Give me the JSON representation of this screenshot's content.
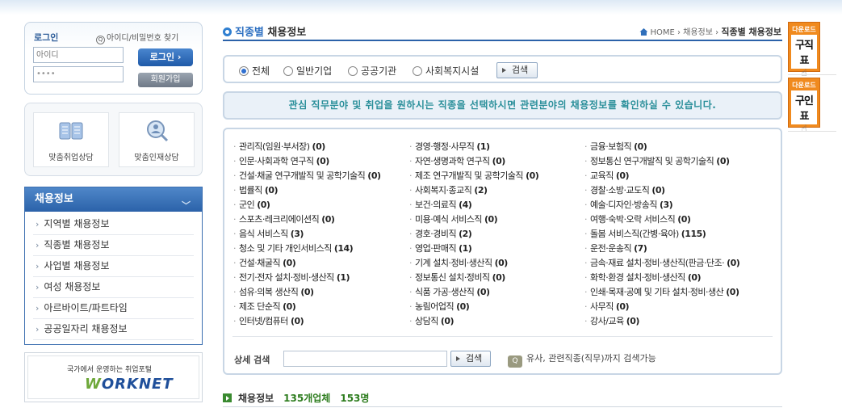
{
  "login": {
    "title": "로그인",
    "find_link": "아이디/비밀번호 찾기",
    "id_placeholder": "아이디",
    "pw_value": "••••",
    "login_button": "로그인",
    "join_button": "회원가입"
  },
  "consult": {
    "item1": "맞춤취업상담",
    "item2": "맞춤인재상담"
  },
  "side_menu": {
    "title": "채용정보",
    "items": [
      "지역별 채용정보",
      "직종별 채용정보",
      "사업별 채용정보",
      "여성 채용정보",
      "아르바이트/파트타임",
      "공공일자리 채용정보"
    ]
  },
  "banner": {
    "tagline": "국가에서 운영하는 취업포털",
    "logo": "ORKNET",
    "logo_w": "W"
  },
  "page": {
    "title_prefix": "직종별",
    "title_suffix": "채용정보",
    "breadcrumb": {
      "home": "HOME",
      "level1": "채용정보",
      "current": "직종별 채용정보"
    }
  },
  "filter": {
    "options": [
      "전체",
      "일반기업",
      "공공기관",
      "사회복지시설"
    ],
    "selected_index": 0,
    "search_button": "검색"
  },
  "notice": "관심 직무분야 및 취업을 원하시는 직종을 선택하시면 관련분야의 채용정보를 확인하실 수 있습니다.",
  "categories": {
    "col1": [
      {
        "name": "관리직(임원·부서장)",
        "count": "(0)"
      },
      {
        "name": "인문·사회과학 연구직",
        "count": "(0)"
      },
      {
        "name": "건설·채굴 연구개발직 및 공학기술직",
        "count": "(0)"
      },
      {
        "name": "법률직",
        "count": "(0)"
      },
      {
        "name": "군인",
        "count": "(0)"
      },
      {
        "name": "스포츠·레크리에이션직",
        "count": "(0)"
      },
      {
        "name": "음식 서비스직",
        "count": "(3)"
      },
      {
        "name": "청소 및 기타 개인서비스직",
        "count": "(14)"
      },
      {
        "name": "건설·채굴직",
        "count": "(0)"
      },
      {
        "name": "전기·전자 설치·정비·생산직",
        "count": "(1)"
      },
      {
        "name": "섬유·의복 생산직",
        "count": "(0)"
      },
      {
        "name": "제조 단순직",
        "count": "(0)"
      },
      {
        "name": "인터넷/컴퓨터",
        "count": "(0)"
      }
    ],
    "col2": [
      {
        "name": "경영·행정·사무직",
        "count": "(1)"
      },
      {
        "name": "자연·생명과학 연구직",
        "count": "(0)"
      },
      {
        "name": "제조 연구개발직 및 공학기술직",
        "count": "(0)"
      },
      {
        "name": "사회복지·종교직",
        "count": "(2)"
      },
      {
        "name": "보건·의료직",
        "count": "(4)"
      },
      {
        "name": "미용·예식 서비스직",
        "count": "(0)"
      },
      {
        "name": "경호·경비직",
        "count": "(2)"
      },
      {
        "name": "영업·판매직",
        "count": "(1)"
      },
      {
        "name": "기계 설치·정비·생산직",
        "count": "(0)"
      },
      {
        "name": "정보통신 설치·정비직",
        "count": "(0)"
      },
      {
        "name": "식품 가공·생산직",
        "count": "(0)"
      },
      {
        "name": "농림어업직",
        "count": "(0)"
      },
      {
        "name": "상담직",
        "count": "(0)"
      }
    ],
    "col3": [
      {
        "name": "금융·보험직",
        "count": "(0)"
      },
      {
        "name": "정보통신 연구개발직 및 공학기술직",
        "count": "(0)"
      },
      {
        "name": "교육직",
        "count": "(0)"
      },
      {
        "name": "경찰·소방·교도직",
        "count": "(0)"
      },
      {
        "name": "예술·디자인·방송직",
        "count": "(3)"
      },
      {
        "name": "여행·숙박·오락 서비스직",
        "count": "(0)"
      },
      {
        "name": "돌봄 서비스직(간병·육아)",
        "count": "(115)"
      },
      {
        "name": "운전·운송직",
        "count": "(7)"
      },
      {
        "name": "금속·재료 설치·정비·생산직(판금·단조·",
        "count": "(0)"
      },
      {
        "name": "화학·환경 설치·정비·생산직",
        "count": "(0)"
      },
      {
        "name": "인쇄·목재·공예 및 기타 설치·정비·생산",
        "count": "(0)"
      },
      {
        "name": "사무직",
        "count": "(0)"
      },
      {
        "name": "강사/교육",
        "count": "(0)"
      }
    ]
  },
  "detail_search": {
    "label": "상세 검색",
    "button": "검색",
    "hint_icon": "Q",
    "hint": "유사, 관련직종(직무)까지 검색가능"
  },
  "summary": {
    "label": "채용정보",
    "companies": "135개업체",
    "postings": "153명"
  },
  "downloads": [
    {
      "top": "다운로드",
      "title": "구직표"
    },
    {
      "top": "다운로드",
      "title": "구인표"
    }
  ],
  "colors": {
    "primary_blue": "#2b62a9",
    "notice_text": "#2a8f9a",
    "download_orange": "#f08a1e"
  }
}
